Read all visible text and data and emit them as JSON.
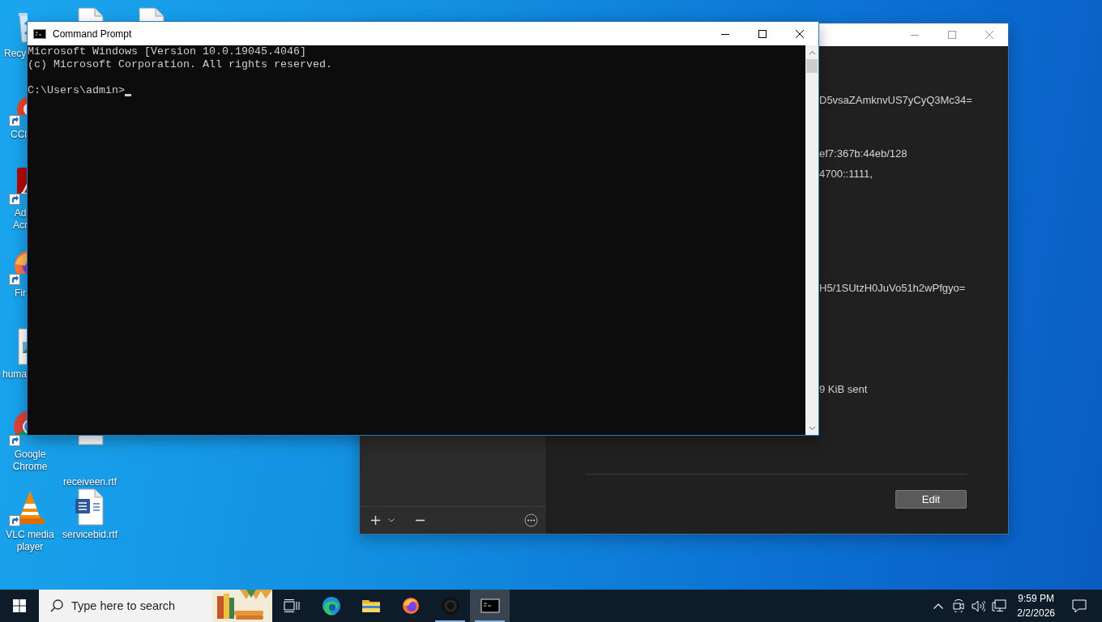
{
  "desktop": {
    "icons": [
      {
        "label": "Recy",
        "shortcut": false
      },
      {
        "shortcut": false
      },
      {
        "shortcut": false
      },
      {
        "label": "CCl",
        "shortcut": true
      },
      {
        "label": "Ad Acr",
        "shortcut": true
      },
      {
        "label": "Fir",
        "shortcut": true
      },
      {
        "label": "huma",
        "shortcut": false
      },
      {
        "label": "Google Chrome",
        "shortcut": true
      },
      {
        "label": "receiveen.rtf",
        "shortcut": false
      },
      {
        "label": "VLC media player",
        "shortcut": true
      },
      {
        "label": "servicebid.rtf",
        "shortcut": false
      }
    ]
  },
  "wireguard_window": {
    "details": [
      "D5vsaZAmknvUS7yCyQ3Mc34=",
      "ef7:367b:44eb/128",
      "4700::1111,",
      "H5/1SUtzH0JuVo51h2wPfgyo=",
      "9 KiB sent"
    ],
    "edit_button": "Edit"
  },
  "command_prompt": {
    "title": "Command Prompt",
    "output": [
      "Microsoft Windows [Version 10.0.19045.4046]",
      "(c) Microsoft Corporation. All rights reserved."
    ],
    "prompt": "C:\\Users\\admin>",
    "cursor": true
  },
  "taskbar": {
    "search": {
      "placeholder": "Type here to search"
    },
    "apps": [
      {
        "selected": false,
        "running": false
      },
      {
        "selected": false,
        "running": false
      },
      {
        "selected": false,
        "running": false
      },
      {
        "selected": false,
        "running": true
      },
      {
        "selected": true,
        "running": true
      }
    ],
    "clock": {
      "time": "9:59 PM",
      "date": "2/2/2026"
    }
  }
}
